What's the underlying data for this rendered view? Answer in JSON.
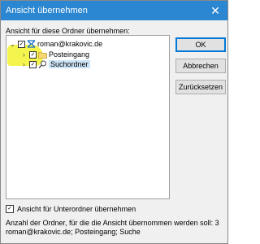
{
  "window": {
    "title": "Ansicht übernehmen",
    "close_glyph": "✕"
  },
  "instruction": "Ansicht für diese Ordner übernehmen:",
  "tree": {
    "root": {
      "label": "roman@krakovic.de",
      "checked": true,
      "expanded": true,
      "icon": "mail-account-icon"
    },
    "children": [
      {
        "label": "Posteingang",
        "checked": true,
        "expanded": false,
        "icon": "folder-icon",
        "selected": false
      },
      {
        "label": "Suchordner",
        "checked": true,
        "expanded": false,
        "icon": "search-folder-icon",
        "selected": true
      }
    ]
  },
  "glyphs": {
    "check": "✓",
    "expanded": "⌄",
    "collapsed": "›"
  },
  "buttons": {
    "ok": "OK",
    "cancel": "Abbrechen",
    "reset": "Zurücksetzen"
  },
  "subfolder_option": {
    "label": "Ansicht für Unterordner übernehmen",
    "checked": true
  },
  "info": {
    "count_text": "Anzahl der Ordner, für die die Ansicht übernommen werden soll: 3",
    "folders_text": "roman@krakovic.de; Posteingang; Suche"
  },
  "colors": {
    "titlebar": "#2b87d1",
    "highlight": "#f2f230",
    "selection": "#cce4f7",
    "default_button_border": "#0078d7"
  }
}
